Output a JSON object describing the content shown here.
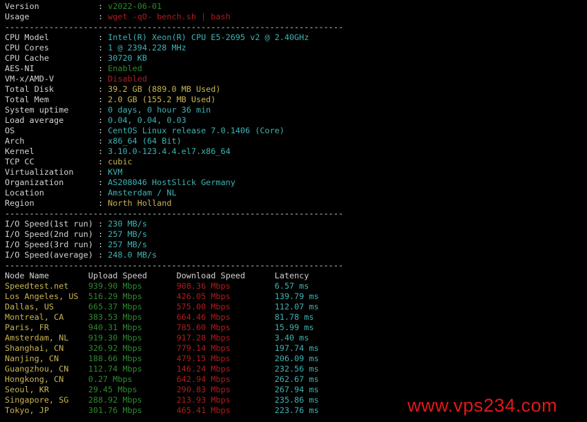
{
  "colors": {
    "label": "#d4d4d4",
    "cyan": "#3fb3b3",
    "yellow": "#c9b552",
    "green": "#2d8a2d",
    "red": "#b01c1c",
    "watermark": "#e01818"
  },
  "header": [
    {
      "label": "Version",
      "value": "v2022-06-01",
      "color": "green"
    },
    {
      "label": "Usage",
      "value": "wget -qO- bench.sh | bash",
      "color": "red"
    }
  ],
  "divider": "---------------------------------------------------------------------",
  "system": [
    {
      "label": "CPU Model",
      "value": "Intel(R) Xeon(R) CPU E5-2695 v2 @ 2.40GHz",
      "color": "cyan"
    },
    {
      "label": "CPU Cores",
      "value": "1 @ 2394.228 MHz",
      "color": "cyan"
    },
    {
      "label": "CPU Cache",
      "value": "30720 KB",
      "color": "cyan"
    },
    {
      "label": "AES-NI",
      "value": "Enabled",
      "color": "green"
    },
    {
      "label": "VM-x/AMD-V",
      "value": "Disabled",
      "color": "red"
    },
    {
      "label": "Total Disk",
      "value": "39.2 GB (889.0 MB Used)",
      "color": "yellow"
    },
    {
      "label": "Total Mem",
      "value": "2.0 GB (155.2 MB Used)",
      "color": "yellow"
    },
    {
      "label": "System uptime",
      "value": "0 days, 0 hour 36 min",
      "color": "cyan"
    },
    {
      "label": "Load average",
      "value": "0.04, 0.04, 0.03",
      "color": "cyan"
    },
    {
      "label": "OS",
      "value": "CentOS Linux release 7.0.1406 (Core)",
      "color": "cyan"
    },
    {
      "label": "Arch",
      "value": "x86_64 (64 Bit)",
      "color": "cyan"
    },
    {
      "label": "Kernel",
      "value": "3.10.0-123.4.4.el7.x86_64",
      "color": "cyan"
    },
    {
      "label": "TCP CC",
      "value": "cubic",
      "color": "yellow"
    },
    {
      "label": "Virtualization",
      "value": "KVM",
      "color": "cyan"
    },
    {
      "label": "Organization",
      "value": "AS208046 HostSlick Germany",
      "color": "cyan"
    },
    {
      "label": "Location",
      "value": "Amsterdam / NL",
      "color": "cyan"
    },
    {
      "label": "Region",
      "value": "North Holland",
      "color": "yellow"
    }
  ],
  "io": [
    {
      "label": "I/O Speed(1st run)",
      "value": "230 MB/s",
      "color": "cyan"
    },
    {
      "label": "I/O Speed(2nd run)",
      "value": "257 MB/s",
      "color": "cyan"
    },
    {
      "label": "I/O Speed(3rd run)",
      "value": "257 MB/s",
      "color": "cyan"
    },
    {
      "label": "I/O Speed(average)",
      "value": "248.0 MB/s",
      "color": "cyan"
    }
  ],
  "speedtest": {
    "columns": [
      "Node Name",
      "Upload Speed",
      "Download Speed",
      "Latency"
    ],
    "rows": [
      [
        "Speedtest.net",
        "939.90 Mbps",
        "908.36 Mbps",
        "6.57 ms"
      ],
      [
        "Los Angeles, US",
        "516.29 Mbps",
        "426.05 Mbps",
        "139.79 ms"
      ],
      [
        "Dallas, US",
        "665.37 Mbps",
        "575.00 Mbps",
        "112.07 ms"
      ],
      [
        "Montreal, CA",
        "383.53 Mbps",
        "664.46 Mbps",
        "81.78 ms"
      ],
      [
        "Paris, FR",
        "940.31 Mbps",
        "785.60 Mbps",
        "15.99 ms"
      ],
      [
        "Amsterdam, NL",
        "919.30 Mbps",
        "917.28 Mbps",
        "3.40 ms"
      ],
      [
        "Shanghai, CN",
        "326.92 Mbps",
        "779.14 Mbps",
        "197.74 ms"
      ],
      [
        "Nanjing, CN",
        "188.66 Mbps",
        "479.15 Mbps",
        "206.09 ms"
      ],
      [
        "Guangzhou, CN",
        "112.74 Mbps",
        "146.24 Mbps",
        "232.56 ms"
      ],
      [
        "Hongkong, CN",
        "0.27 Mbps",
        "642.94 Mbps",
        "262.67 ms"
      ],
      [
        "Seoul, KR",
        "29.45 Mbps",
        "290.83 Mbps",
        "267.94 ms"
      ],
      [
        "Singapore, SG",
        "288.92 Mbps",
        "213.93 Mbps",
        "235.86 ms"
      ],
      [
        "Tokyo, JP",
        "301.76 Mbps",
        "465.41 Mbps",
        "223.76 ms"
      ]
    ]
  },
  "watermark": "www.vps234.com"
}
